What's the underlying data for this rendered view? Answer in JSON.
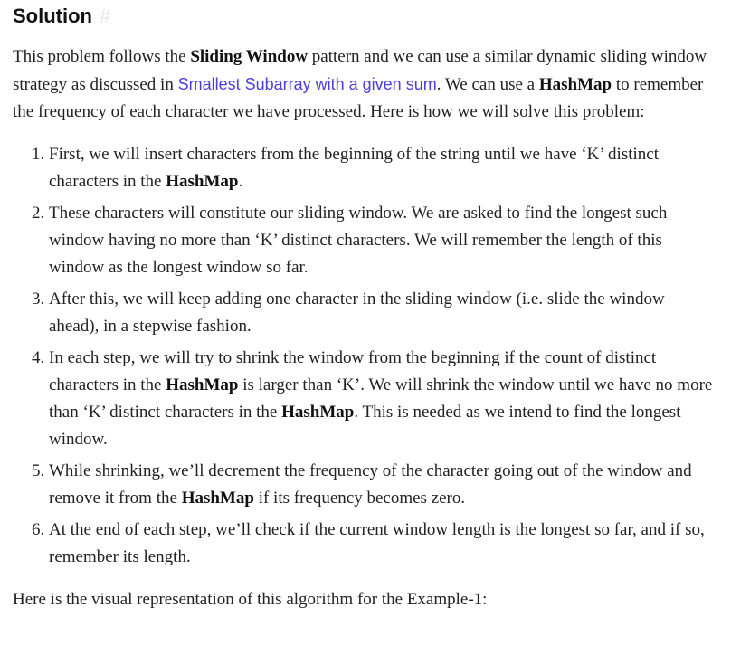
{
  "heading": {
    "text": "Solution",
    "anchor": "#"
  },
  "intro": {
    "t1": "This problem follows the ",
    "b1": "Sliding Window",
    "t2": " pattern and we can use a similar dynamic sliding window strategy as discussed in ",
    "link": "Smallest Subarray with a given sum",
    "t3": ". We can use a ",
    "b2": "HashMap",
    "t4": " to remember the frequency of each character we have processed. Here is how we will solve this problem:"
  },
  "steps": [
    {
      "t1": "First, we will insert characters from the beginning of the string until we have ‘K’ distinct characters in the ",
      "b1": "HashMap",
      "t2": "."
    },
    {
      "t1": "These characters will constitute our sliding window. We are asked to find the longest such window having no more than ‘K’ distinct characters. We will remember the length of this window as the longest window so far."
    },
    {
      "t1": "After this, we will keep adding one character in the sliding window (i.e. slide the window ahead), in a stepwise fashion."
    },
    {
      "t1": "In each step, we will try to shrink the window from the beginning if the count of distinct characters in the ",
      "b1": "HashMap",
      "t2": " is larger than ‘K’. We will shrink the window until we have no more than ‘K’ distinct characters in the ",
      "b2": "HashMap",
      "t3": ". This is needed as we intend to find the longest window."
    },
    {
      "t1": "While shrinking, we’ll decrement the frequency of the character going out of the window and remove it from the ",
      "b1": "HashMap",
      "t2": " if its frequency becomes zero."
    },
    {
      "t1": "At the end of each step, we’ll check if the current window length is the longest so far, and if so, remember its length."
    }
  ],
  "outro": "Here is the visual representation of this algorithm for the Example-1:"
}
